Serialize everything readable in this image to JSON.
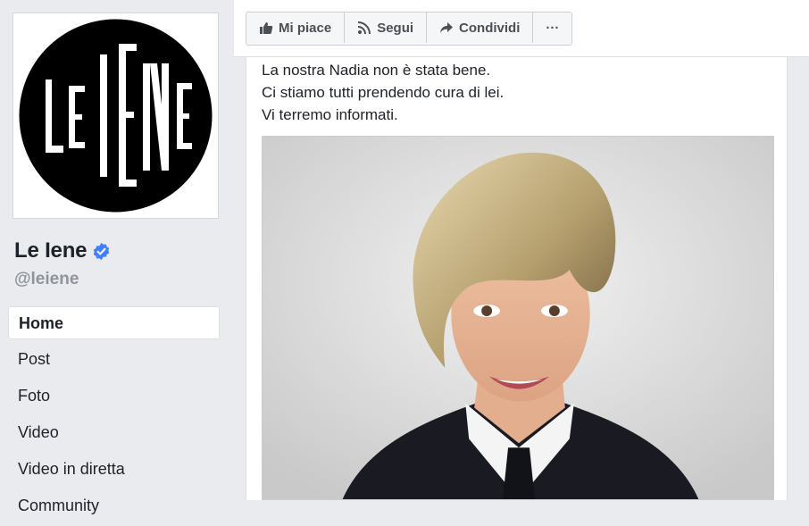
{
  "page": {
    "name": "Le Iene",
    "handle": "@leiene",
    "logo_text": "LE IENE"
  },
  "nav": {
    "items": [
      {
        "label": "Home",
        "active": true
      },
      {
        "label": "Post"
      },
      {
        "label": "Foto"
      },
      {
        "label": "Video"
      },
      {
        "label": "Video in diretta"
      },
      {
        "label": "Community"
      }
    ]
  },
  "toolbar": {
    "like_label": "Mi piace",
    "follow_label": "Segui",
    "share_label": "Condividi",
    "more_label": "···"
  },
  "post": {
    "lines": [
      "La nostra Nadia non è stata bene.",
      "Ci stiamo tutti prendendo cura di lei.",
      "Vi terremo informati."
    ]
  },
  "colors": {
    "background": "#e9ebee",
    "verified": "#4080ff",
    "text": "#1d2129",
    "muted": "#90949c"
  },
  "icons": {
    "like": "thumbs-up-icon",
    "follow": "rss-icon",
    "share": "share-arrow-icon",
    "verified": "verified-badge-icon"
  }
}
